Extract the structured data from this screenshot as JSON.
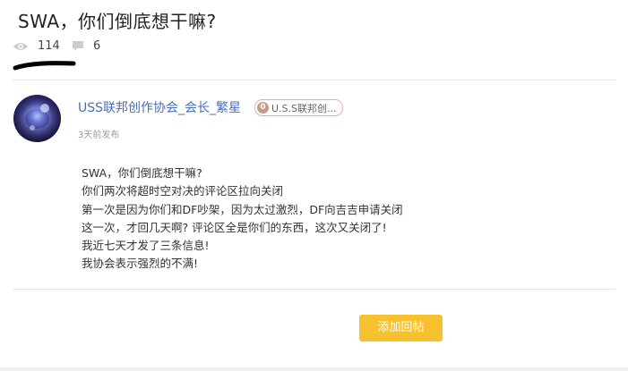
{
  "post": {
    "title": "SWA，你们倒底想干嘛?",
    "views": "114",
    "comments": "6"
  },
  "author": {
    "username": "USS联邦创作协会_会长_繁星",
    "badge_count": "0",
    "badge_label": "U.S.S联邦创...",
    "time": "3天前发布"
  },
  "content": {
    "lines": [
      "SWA，你们倒底想干嘛?",
      "你们两次将超时空对决的评论区拉向关闭",
      "第一次是因为你们和DF吵架，因为太过激烈，DF向吉吉申请关闭",
      "这一次，才回几天啊? 评论区全是你们的东西，这次又关闭了!",
      "我近七天才发了三条信息!",
      "我协会表示强烈的不满!"
    ]
  },
  "actions": {
    "reply_label": "添加回帖"
  },
  "icons": {
    "views": "eye-icon",
    "comments": "comment-icon"
  },
  "colors": {
    "username": "#4a6fb7",
    "button": "#f7c02e",
    "badge": "#c59a8e"
  }
}
